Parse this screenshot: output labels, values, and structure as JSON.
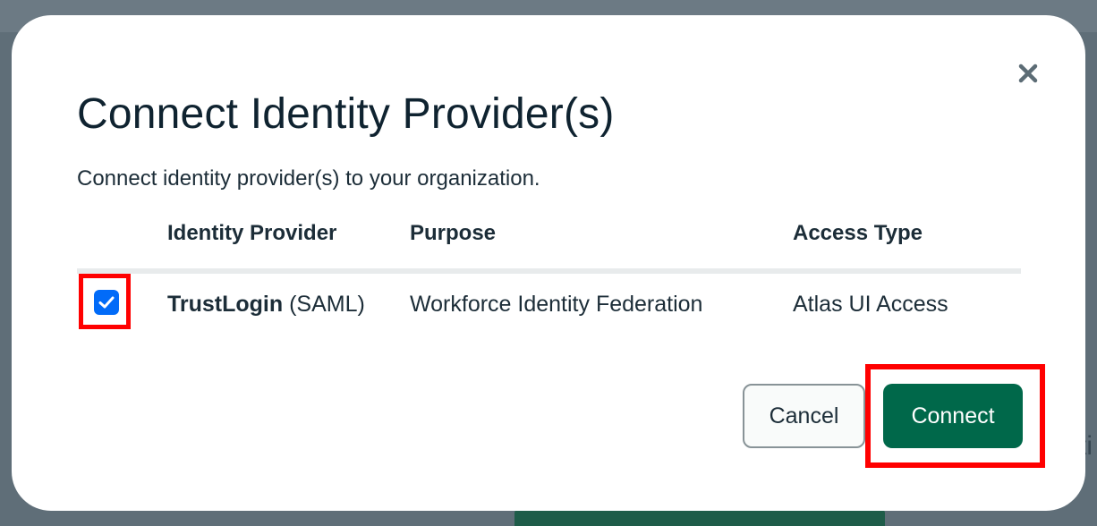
{
  "modal": {
    "title": "Connect Identity Provider(s)",
    "subtitle": "Connect identity provider(s) to your organization.",
    "close_icon": "close-icon"
  },
  "table": {
    "columns": [
      "Identity Provider",
      "Purpose",
      "Access Type"
    ],
    "rows": [
      {
        "checked": true,
        "provider_name": "TrustLogin",
        "provider_protocol": "(SAML)",
        "purpose": "Workforce Identity Federation",
        "access_type": "Atlas UI Access"
      }
    ]
  },
  "actions": {
    "cancel_label": "Cancel",
    "connect_label": "Connect"
  },
  "background": {
    "partial_text": "ti"
  },
  "colors": {
    "primary": "#00684a",
    "checkbox": "#016bf8",
    "highlight": "#ff0000"
  }
}
